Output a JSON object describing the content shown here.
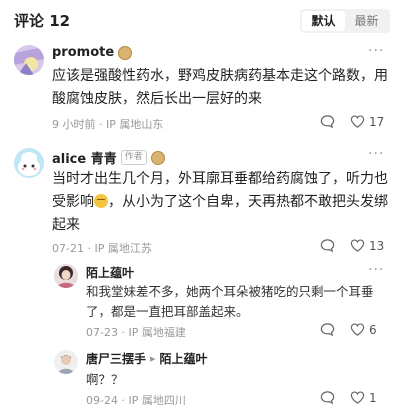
{
  "header": {
    "title": "评论 12",
    "sort_default": "默认",
    "sort_latest": "最新"
  },
  "comments": [
    {
      "username": "promote",
      "text": "应该是强酸性药水，野鸡皮肤病药基本走这个路数，用酸腐蚀皮肤，然后长出一层好的来",
      "meta": "9 小时前 · IP 属地山东",
      "likes": "17"
    },
    {
      "username": "alice 青青",
      "author_badge": "作者",
      "text_before_emoji": "当时才出生几个月，外耳廓耳垂都给药腐蚀了，听力也受影响",
      "text_after_emoji": "，从小为了这个自卑，天再热都不敢把头发绑起来",
      "meta": "07-21 · IP 属地江苏",
      "likes": "13"
    }
  ],
  "replies": [
    {
      "username": "陌上蕴叶",
      "text": "和我堂妹差不多，她两个耳朵被猪吃的只剩一个耳垂了，都是一直把耳部盖起来。",
      "meta": "07-23 · IP 属地福建",
      "likes": "6"
    },
    {
      "username": "唐尸三摆手",
      "reply_to": "陌上蕴叶",
      "reply_arrow": "▸",
      "text": "啊？？",
      "meta": "09-24 · IP 属地四川",
      "likes": "1"
    }
  ],
  "icons": {
    "more": "···"
  }
}
